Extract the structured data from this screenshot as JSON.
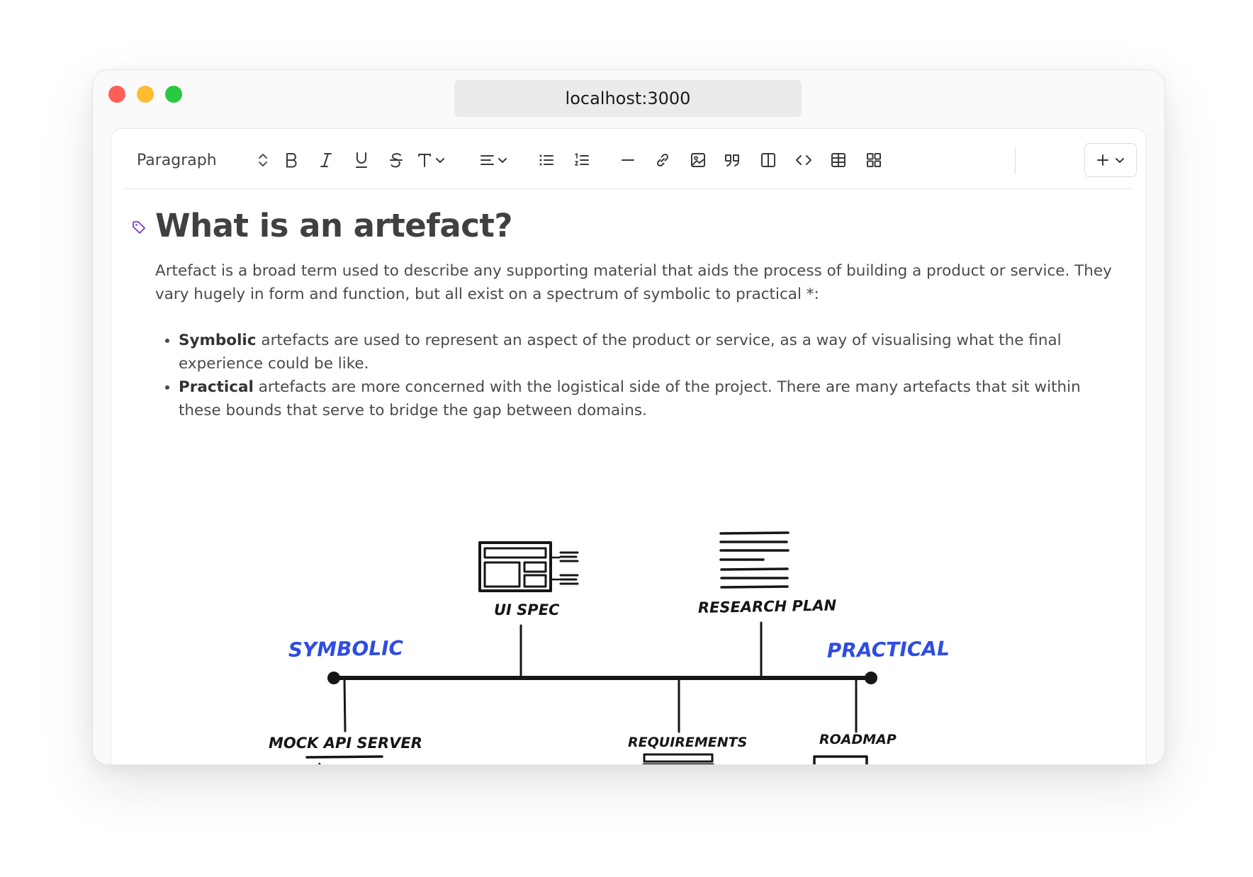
{
  "browser": {
    "url": "localhost:3000"
  },
  "toolbar": {
    "block_type": "Paragraph",
    "icons": [
      "bold-icon",
      "italic-icon",
      "underline-icon",
      "strikethrough-icon",
      "text-style-icon",
      "align-icon",
      "bullet-list-icon",
      "ordered-list-icon",
      "horizontal-rule-icon",
      "link-icon",
      "image-icon",
      "quote-icon",
      "columns-icon",
      "code-icon",
      "table-icon",
      "grid-icon",
      "plus-icon"
    ]
  },
  "document": {
    "heading": "What is an artefact?",
    "intro": "Artefact is a broad term used to describe any supporting material that aids the process of building a product or service. They vary hugely in form and function, but all exist on a spectrum of symbolic to practical *:",
    "bullets": [
      {
        "bold": "Symbolic",
        "text": " artefacts are used to represent an aspect of the product or service, as a way of visualising what the final experience could be like."
      },
      {
        "bold": "Practical",
        "text": " artefacts are more concerned with the logistical side of the project. There are many artefacts that sit within these bounds that serve to bridge the gap between domains."
      }
    ]
  },
  "diagram": {
    "start_label": "SYMBOLIC",
    "end_label": "PRACTICAL",
    "accent_color": "#2f4de0",
    "items": {
      "ui_spec": "UI SPEC",
      "research_plan": "RESEARCH PLAN",
      "mock_api": "MOCK API SERVER",
      "requirements": "REQUIREMENTS",
      "roadmap": "ROADMAP"
    }
  }
}
